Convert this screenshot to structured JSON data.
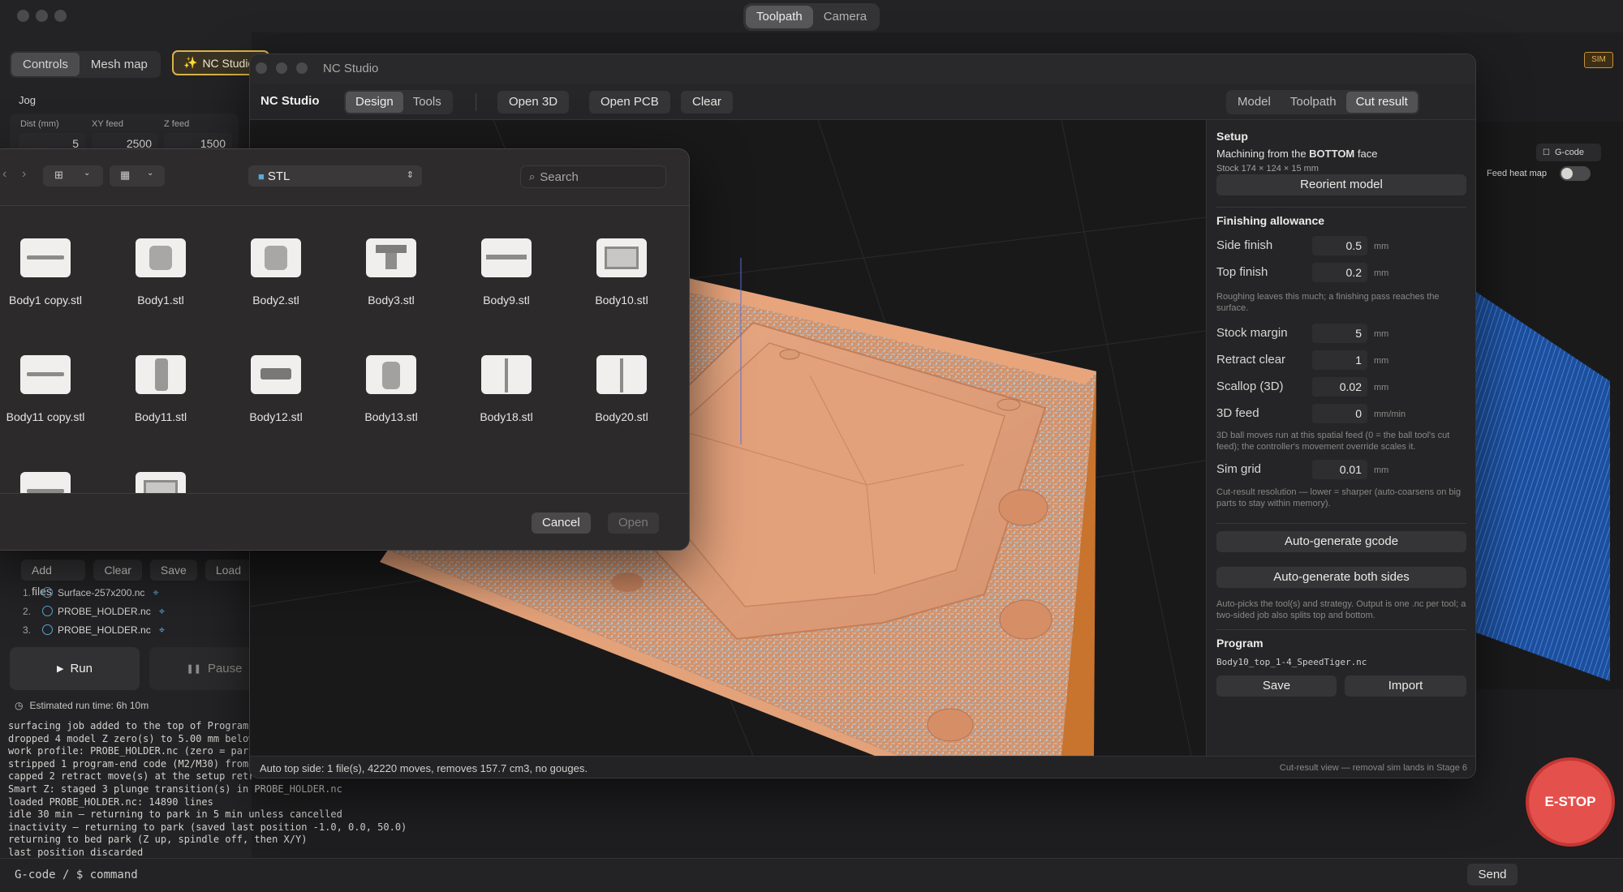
{
  "main": {
    "top_tabs": [
      {
        "label": "Toolpath"
      },
      {
        "label": "Camera"
      }
    ],
    "left_tabs": [
      {
        "label": "Controls"
      },
      {
        "label": "Mesh map"
      },
      {
        "label": "NC Studio"
      }
    ],
    "sim_badge": "SIM",
    "gcode_toggle_label": "G-code",
    "feed_heat_map_label": "Feed heat map",
    "jog": {
      "title": "Jog",
      "dist_label": "Dist (mm)",
      "dist_value": "5",
      "xy_label": "XY feed",
      "xy_value": "2500",
      "z_label": "Z feed",
      "z_value": "1500"
    },
    "program_buttons": {
      "add": "Add files",
      "clear": "Clear",
      "save": "Save",
      "load": "Load"
    },
    "program_files": [
      {
        "num": "1.",
        "name": "Surface-257x200.nc"
      },
      {
        "num": "2.",
        "name": "PROBE_HOLDER.nc"
      },
      {
        "num": "3.",
        "name": "PROBE_HOLDER.nc"
      }
    ],
    "run_label": "Run",
    "pause_label": "Pause",
    "est_time": "Estimated run time: 6h 10m",
    "console": [
      "surfacing job added to the top of Program",
      "dropped 4 model Z zero(s) to 5.00 mm below",
      "work profile: PROBE_HOLDER.nc (zero = park",
      "stripped 1 program-end code (M2/M30) from",
      "capped 2 retract move(s) at the setup retr",
      "Smart Z: staged 3 plunge transition(s) in PROBE_HOLDER.nc",
      "loaded PROBE_HOLDER.nc: 14890 lines",
      "idle 30 min — returning to park in 5 min unless cancelled",
      "inactivity — returning to park (saved last position -1.0, 0.0, 50.0)",
      "returning to bed park (Z up, spindle off, then X/Y)",
      "last position discarded"
    ],
    "command_placeholder": "G-code / $ command",
    "send_label": "Send",
    "estop_label": "E-STOP"
  },
  "nc": {
    "window_title": "NC Studio",
    "app_name": "NC Studio",
    "mode_tabs": [
      {
        "label": "Design"
      },
      {
        "label": "Tools"
      }
    ],
    "open3d": "Open 3D",
    "openpcb": "Open PCB",
    "clear": "Clear",
    "view_tabs": [
      {
        "label": "Model"
      },
      {
        "label": "Toolpath"
      },
      {
        "label": "Cut result"
      }
    ],
    "setup": {
      "title": "Setup",
      "machining_prefix": "Machining from the ",
      "machining_face": "BOTTOM",
      "machining_suffix": " face",
      "stock": "Stock 174 × 124 × 15 mm",
      "reorient": "Reorient model"
    },
    "finishing": {
      "title": "Finishing allowance",
      "side_label": "Side finish",
      "side_value": "0.5",
      "top_label": "Top finish",
      "top_value": "0.2",
      "hint": "Roughing leaves this much; a finishing pass reaches the surface.",
      "stock_margin_label": "Stock margin",
      "stock_margin_value": "5",
      "retract_label": "Retract clear",
      "retract_value": "1",
      "scallop_label": "Scallop (3D)",
      "scallop_value": "0.02",
      "feed3d_label": "3D feed",
      "feed3d_value": "0",
      "feed3d_unit": "mm/min",
      "feed3d_hint": "3D ball moves run at this spatial feed (0 = the ball tool's cut feed); the controller's movement override scales it.",
      "simgrid_label": "Sim grid",
      "simgrid_value": "0.01",
      "simgrid_hint": "Cut-result resolution — lower = sharper (auto-coarsens on big parts to stay within memory).",
      "unit_mm": "mm"
    },
    "autogen": "Auto-generate gcode",
    "autogen_both": "Auto-generate both sides",
    "autogen_hint": "Auto-picks the tool(s) and strategy. Output is one .nc per tool; a two-sided job also splits top and bottom.",
    "program": {
      "title": "Program",
      "file": "Body10_top_1-4_SpeedTiger.nc",
      "save": "Save",
      "import": "Import"
    },
    "status_left": "Auto top side: 1 file(s), 42220 moves, removes 157.7 cm3, no gouges.",
    "status_right": "Cut-result view — removal sim lands in Stage 6"
  },
  "dialog": {
    "folder": "STL",
    "search_placeholder": "Search",
    "files": [
      {
        "name": "Body1 copy.stl",
        "icon": "flat-bar-thumb"
      },
      {
        "name": "Body1.stl",
        "icon": "cylinder-thumb"
      },
      {
        "name": "Body2.stl",
        "icon": "cylinder-thumb"
      },
      {
        "name": "Body3.stl",
        "icon": "bracket-thumb"
      },
      {
        "name": "Body9.stl",
        "icon": "rail-thumb"
      },
      {
        "name": "Body10.stl",
        "icon": "tray-thumb"
      },
      {
        "name": "Body11 copy.stl",
        "icon": "flat-bar-thumb"
      },
      {
        "name": "Body11.stl",
        "icon": "sleeve-thumb"
      },
      {
        "name": "Body12.stl",
        "icon": "mount-thumb"
      },
      {
        "name": "Body13.stl",
        "icon": "probe-thumb"
      },
      {
        "name": "Body18.stl",
        "icon": "panel-thumb"
      },
      {
        "name": "Body20.stl",
        "icon": "panel-thumb"
      }
    ],
    "cancel": "Cancel",
    "open": "Open"
  },
  "colors": {
    "accent_orange": "#e0a06e",
    "estop_red": "#e4504c",
    "nc_tab_gold": "#d9b44a"
  }
}
